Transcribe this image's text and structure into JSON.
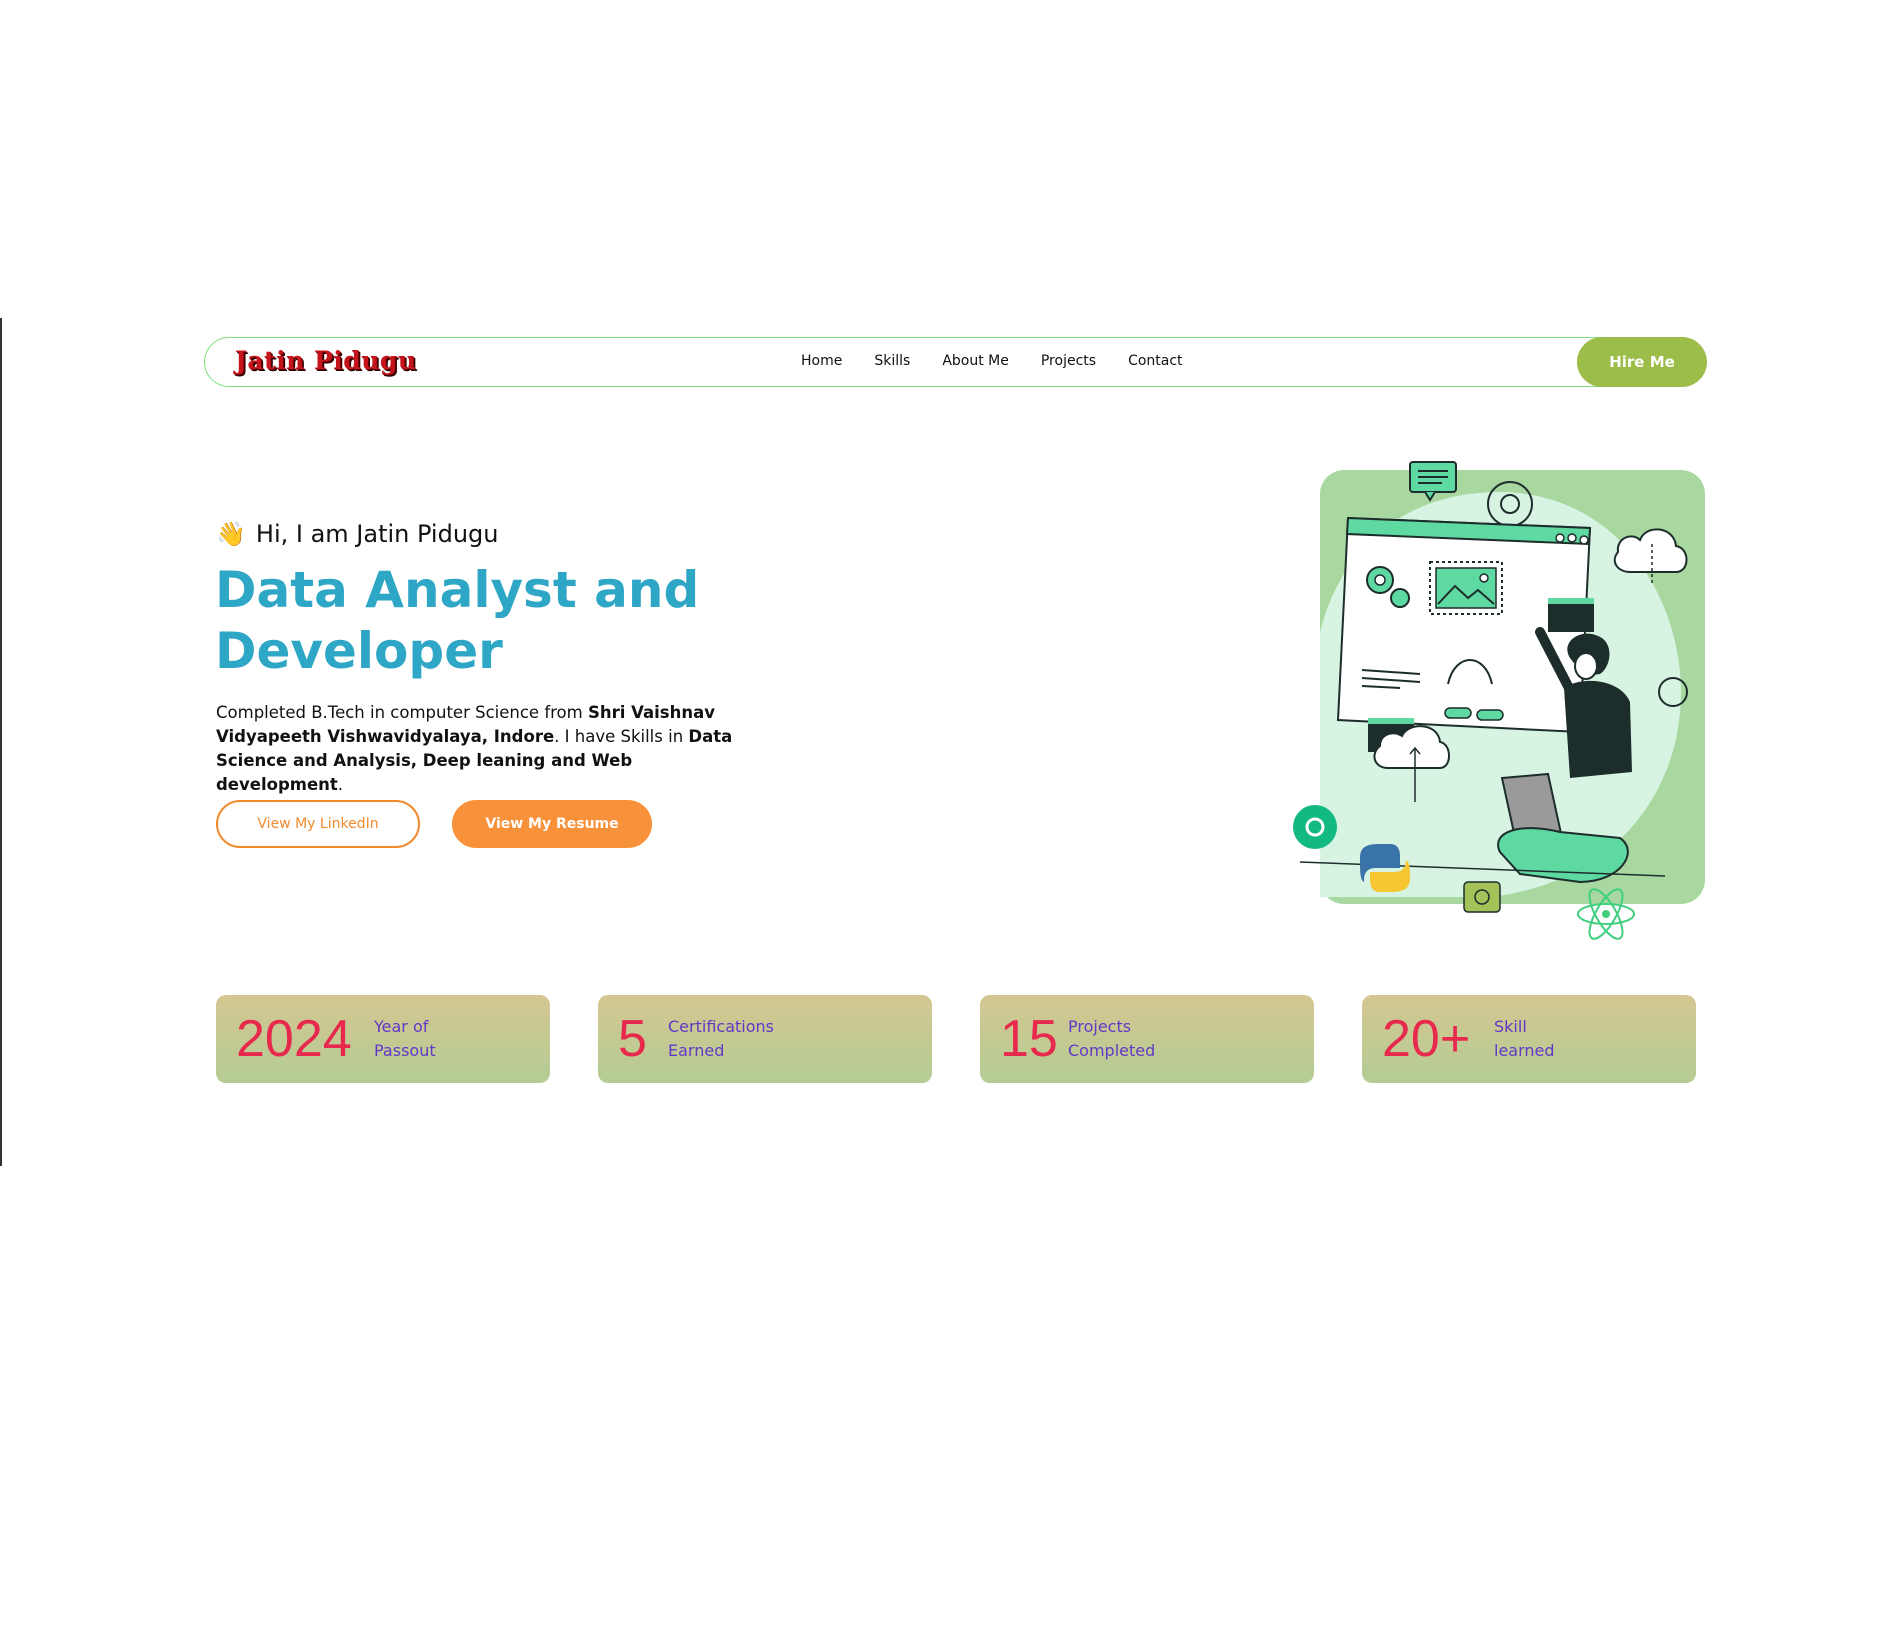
{
  "nav": {
    "brand": "Jatin Pidugu",
    "links": [
      "Home",
      "Skills",
      "About Me",
      "Projects",
      "Contact"
    ],
    "cta": "Hire Me"
  },
  "hero": {
    "wave_emoji": "👋",
    "greeting": "Hi, I am Jatin Pidugu",
    "headline_line1": "Data Analyst and",
    "headline_line2": "Developer",
    "desc": {
      "p1": "Completed B.Tech in computer Science from ",
      "b1": "Shri Vaishnav Vidyapeeth Vishwavidyalaya, Indore",
      "p2": ". I have Skills in ",
      "b2": "Data Science and Analysis, Deep leaning and Web development",
      "p3": "."
    },
    "linkedin_button": "View My LinkedIn",
    "resume_button": "View My Resume"
  },
  "stats": [
    {
      "value": "2024",
      "label_line1": "Year of",
      "label_line2": "Passout"
    },
    {
      "value": "5",
      "label_line1": "Certifications",
      "label_line2": "Earned"
    },
    {
      "value": "15",
      "label_line1": "Projects",
      "label_line2": "Completed"
    },
    {
      "value": "20+",
      "label_line1": "Skill",
      "label_line2": "learned"
    }
  ],
  "colors": {
    "accent_blue": "#2ea6c5",
    "accent_orange": "#f8923a",
    "hire_green": "#9dbd4a",
    "stat_number": "#e8294e",
    "stat_label": "#6238c8"
  },
  "icons": [
    "waving-hand-icon",
    "python-logo-icon",
    "react-atom-icon",
    "gear-icon",
    "cloud-upload-icon",
    "cloud-download-icon",
    "chat-bubble-icon",
    "laptop-icon"
  ]
}
